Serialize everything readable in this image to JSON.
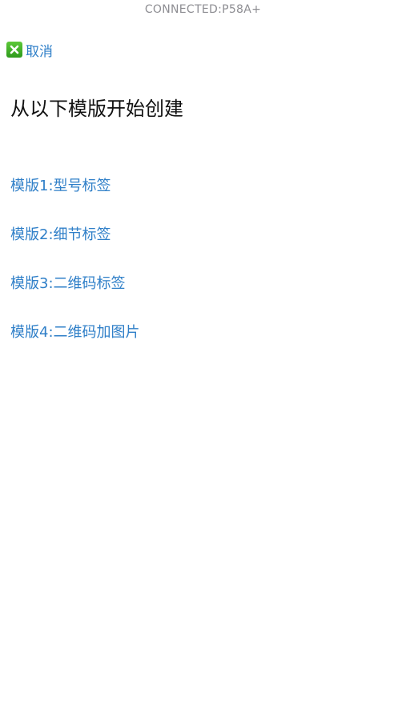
{
  "status_bar": {
    "text": "CONNECTED:P58A+"
  },
  "nav": {
    "cancel_label": "取消",
    "cancel_icon": "close-x-icon"
  },
  "page": {
    "title": "从以下模版开始创建"
  },
  "templates": [
    {
      "label": "模版1:型号标签"
    },
    {
      "label": "模版2:细节标签"
    },
    {
      "label": "模版3:二维码标签"
    },
    {
      "label": "模版4:二维码加图片"
    }
  ],
  "colors": {
    "link": "#2f7fc8",
    "title": "#111111",
    "status": "#8e8e93",
    "icon_green": "#3aa62a"
  }
}
